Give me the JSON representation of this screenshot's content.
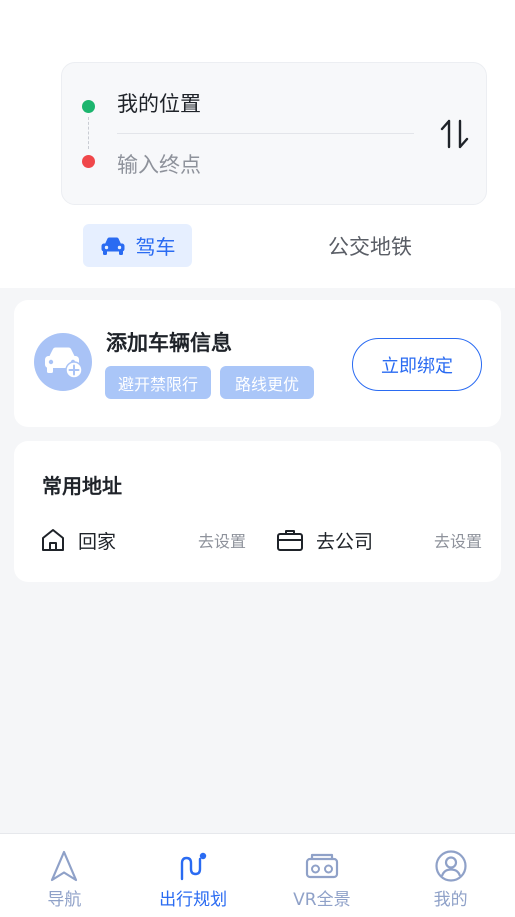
{
  "route": {
    "start_label": "我的位置",
    "end_placeholder": "输入终点"
  },
  "modes": {
    "drive": "驾车",
    "transit": "公交地铁"
  },
  "vehicle": {
    "title": "添加车辆信息",
    "tags": [
      "避开禁限行",
      "路线更优"
    ],
    "bind_button": "立即绑定"
  },
  "addresses": {
    "title": "常用地址",
    "home": {
      "label": "回家",
      "action": "去设置"
    },
    "work": {
      "label": "去公司",
      "action": "去设置"
    }
  },
  "nav": {
    "items": [
      {
        "label": "导航",
        "icon": "navigation-arrow-icon"
      },
      {
        "label": "出行规划",
        "icon": "route-plan-icon"
      },
      {
        "label": "VR全景",
        "icon": "vr-glasses-icon"
      },
      {
        "label": "我的",
        "icon": "user-profile-icon"
      }
    ],
    "active_index": 1
  },
  "colors": {
    "accent": "#2a6bf2",
    "start_dot": "#1cb56e",
    "end_dot": "#f0474a"
  }
}
